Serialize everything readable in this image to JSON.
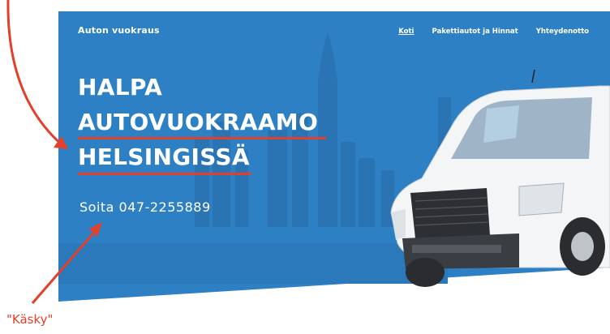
{
  "header": {
    "brand": "Auton vuokraus",
    "nav": [
      {
        "label": "Koti",
        "active": true
      },
      {
        "label": "Pakettiautot ja Hinnat",
        "active": false
      },
      {
        "label": "Yhteydenotto",
        "active": false
      }
    ]
  },
  "hero": {
    "headline": [
      "HALPA",
      "AUTOVUOKRAAMO",
      "HELSINGISSÄ"
    ],
    "phone": "Soita 047-2255889"
  },
  "annotation": {
    "label": "\"Käsky\""
  },
  "colors": {
    "hero_blue": "#2e80c4",
    "annotation_red": "#e2402a",
    "text": "#ffffff"
  },
  "icons": [
    "annotation-arrow-icon",
    "van-image",
    "city-skyline"
  ]
}
